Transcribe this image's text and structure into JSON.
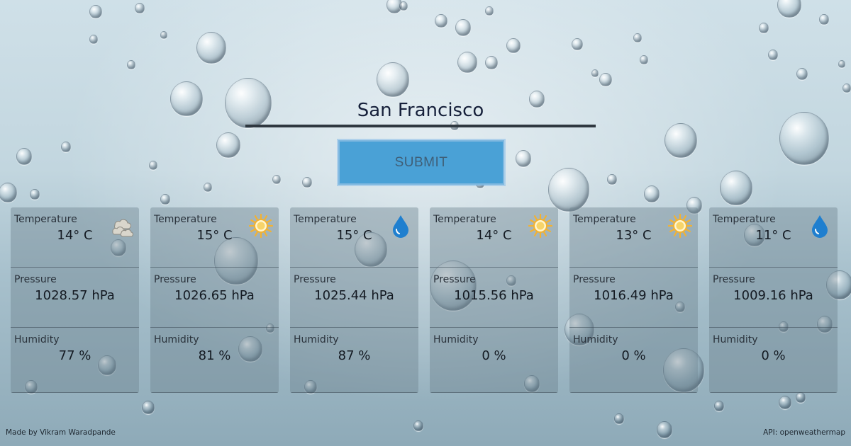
{
  "search": {
    "value": "San Francisco",
    "submit_label": "SUBMIT"
  },
  "cards": [
    {
      "icon": "clouds-icon",
      "temperature_label": "Temperature",
      "temperature": "14° C",
      "pressure_label": "Pressure",
      "pressure": "1028.57 hPa",
      "humidity_label": "Humidity",
      "humidity": "77 %"
    },
    {
      "icon": "sun-icon",
      "temperature_label": "Temperature",
      "temperature": "15° C",
      "pressure_label": "Pressure",
      "pressure": "1026.65 hPa",
      "humidity_label": "Humidity",
      "humidity": "81 %"
    },
    {
      "icon": "raindrop-icon",
      "temperature_label": "Temperature",
      "temperature": "15° C",
      "pressure_label": "Pressure",
      "pressure": "1025.44 hPa",
      "humidity_label": "Humidity",
      "humidity": "87 %"
    },
    {
      "icon": "sun-icon",
      "temperature_label": "Temperature",
      "temperature": "14° C",
      "pressure_label": "Pressure",
      "pressure": "1015.56 hPa",
      "humidity_label": "Humidity",
      "humidity": "0 %"
    },
    {
      "icon": "sun-icon",
      "temperature_label": "Temperature",
      "temperature": "13° C",
      "pressure_label": "Pressure",
      "pressure": "1016.49 hPa",
      "humidity_label": "Humidity",
      "humidity": "0 %"
    },
    {
      "icon": "raindrop-icon",
      "temperature_label": "Temperature",
      "temperature": "11° C",
      "pressure_label": "Pressure",
      "pressure": "1009.16 hPa",
      "humidity_label": "Humidity",
      "humidity": "0 %"
    }
  ],
  "footer": {
    "credit": "Made by Vikram Waradpande",
    "api": "API: openweathermap"
  },
  "colors": {
    "submit_bg": "#4aa1d6",
    "raindrop_icon": "#1f7fcf",
    "sun_icon": "#f2b233"
  }
}
